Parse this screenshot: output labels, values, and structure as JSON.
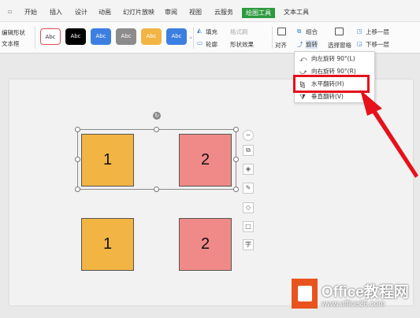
{
  "tabs": [
    "开始",
    "插入",
    "设计",
    "动画",
    "幻灯片放映",
    "审阅",
    "视图",
    "云服务",
    "绘图工具",
    "文本工具"
  ],
  "active_tab": "绘图工具",
  "ribbon": {
    "left_labels": [
      "编辑形状",
      "文本框"
    ],
    "swatch_label": "Abc",
    "swatch_colors": [
      "#ffffff",
      "#000000",
      "#3d7fe0",
      "#8c8c8c",
      "#f2b443",
      "#3d7fe0"
    ],
    "fill": "填充",
    "format_painter": "格式刷",
    "outline": "轮廓",
    "shape_effect": "形状效果",
    "group": "组合",
    "align": "对齐",
    "rotate": "旋转",
    "selection_pane": "选择窗格",
    "bring_forward": "上移一层",
    "send_backward": "下移一层"
  },
  "dropdown": {
    "items": [
      "向左旋转 90°(L)",
      "向右旋转 90°(R)",
      "水平翻转(H)",
      "垂直翻转(V)"
    ]
  },
  "slide": {
    "box_labels": [
      "1",
      "2",
      "1",
      "2"
    ],
    "box_colors": {
      "orange": "#f2b443",
      "pink": "#f08a88"
    }
  },
  "side_tools": [
    "−",
    "⧉",
    "◈",
    "✎",
    "◇",
    "□",
    "字"
  ],
  "watermark": {
    "title": "Office教程网",
    "url": "www.office26.com"
  },
  "colors": {
    "active_tab_bg": "#2e9a3e",
    "highlight": "#e5111b",
    "arrow": "#e5111b"
  }
}
